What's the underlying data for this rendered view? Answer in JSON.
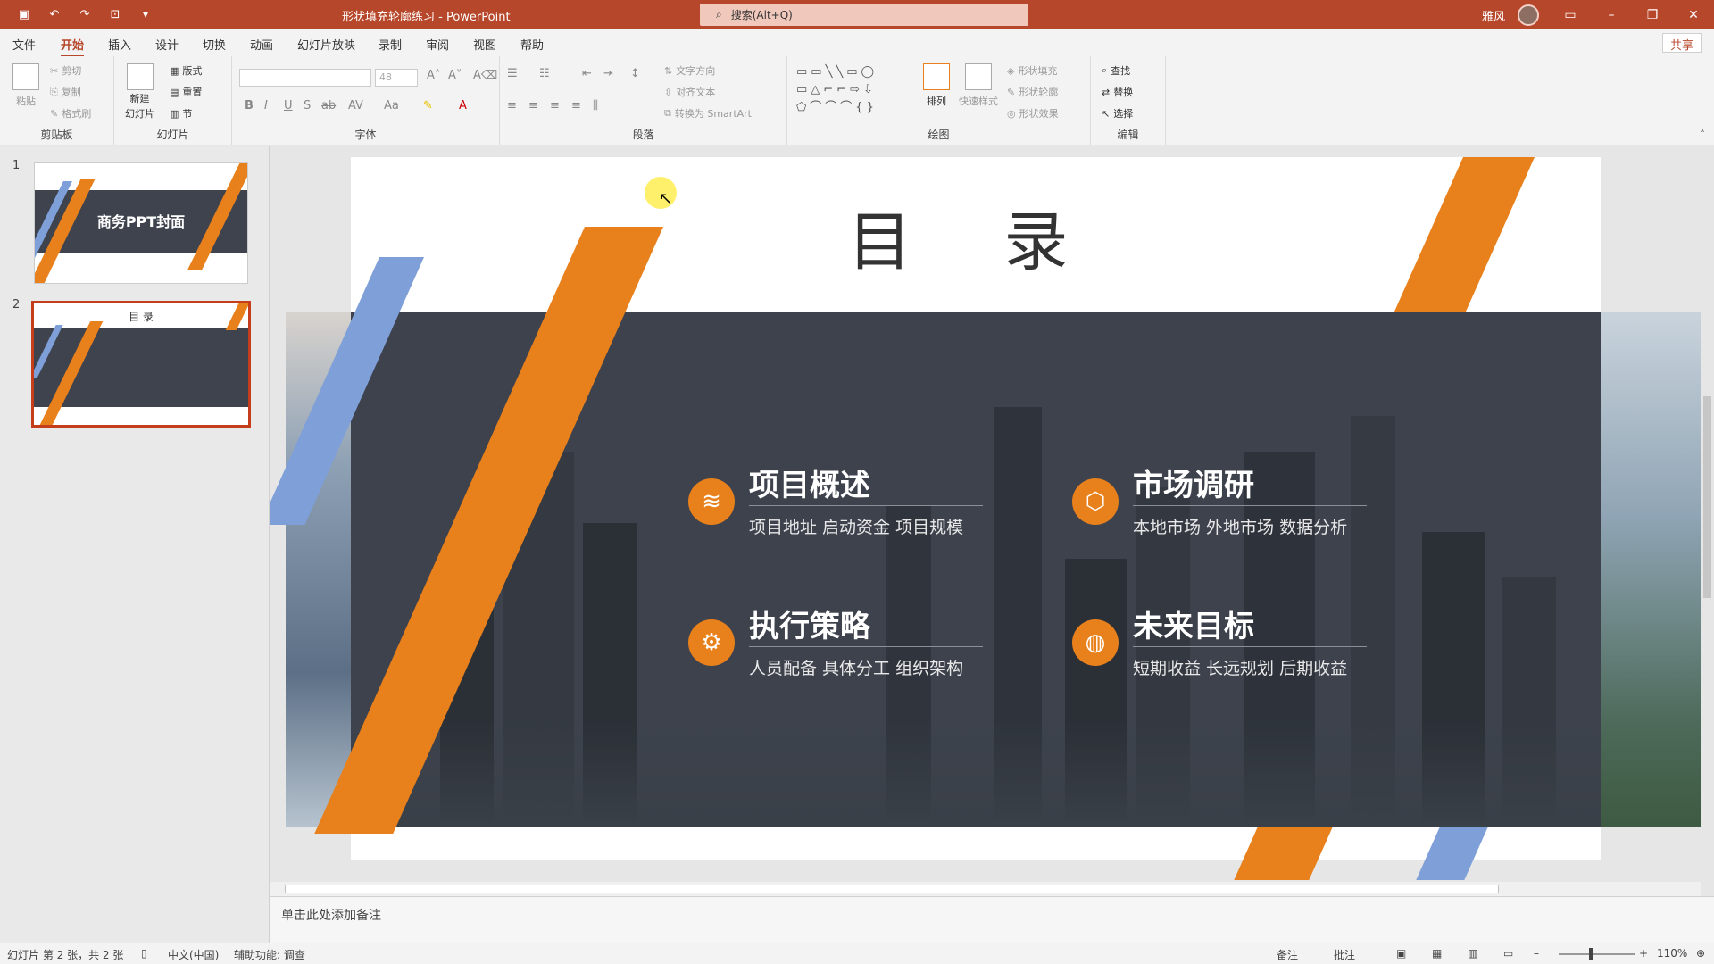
{
  "titlebar": {
    "doc_title": "形状填充轮廓练习  -  PowerPoint",
    "search_placeholder": "搜索(Alt+Q)",
    "user": "雅风"
  },
  "menu": {
    "tabs": [
      "文件",
      "开始",
      "插入",
      "设计",
      "切换",
      "动画",
      "幻灯片放映",
      "录制",
      "审阅",
      "视图",
      "帮助"
    ],
    "active_tab": "开始",
    "share": "共享"
  },
  "ribbon": {
    "clipboard": {
      "label": "剪贴板",
      "paste": "粘贴",
      "cut": "剪切",
      "copy": "复制",
      "format_painter": "格式刷"
    },
    "slides": {
      "label": "幻灯片",
      "new_slide": "新建",
      "new_slide_2": "幻灯片",
      "layout": "版式",
      "reset": "重置",
      "section": "节"
    },
    "font": {
      "label": "字体",
      "size": "48"
    },
    "paragraph": {
      "label": "段落",
      "text_direction": "文字方向",
      "align_text": "对齐文本",
      "smartart": "转换为 SmartArt"
    },
    "drawing": {
      "label": "绘图",
      "arrange": "排列",
      "quick_styles": "快速样式",
      "fill": "形状填充",
      "outline": "形状轮廓",
      "effects": "形状效果"
    },
    "editing": {
      "label": "编辑",
      "find": "查找",
      "replace": "替换",
      "select": "选择"
    }
  },
  "thumbnails": [
    {
      "number": "1",
      "title": "商务PPT封面"
    },
    {
      "number": "2",
      "title": "目  录"
    }
  ],
  "slide": {
    "title": "目  录",
    "items": [
      {
        "heading": "项目概述",
        "sub": "项目地址  启动资金  项目规模",
        "icon": "layers-icon"
      },
      {
        "heading": "市场调研",
        "sub": "本地市场  外地市场  数据分析",
        "icon": "box-icon"
      },
      {
        "heading": "执行策略",
        "sub": "人员配备  具体分工  组织架构",
        "icon": "gear-icon"
      },
      {
        "heading": "未来目标",
        "sub": "短期收益  长远规划  后期收益",
        "icon": "ball-icon"
      }
    ]
  },
  "notes": {
    "placeholder": "单击此处添加备注"
  },
  "status": {
    "slide_info": "幻灯片 第 2 张，共 2 张",
    "language": "中文(中国)",
    "accessibility": "辅助功能: 调查",
    "notes_btn": "备注",
    "comments_btn": "批注",
    "zoom": "110%"
  },
  "colors": {
    "accent": "#b7472a",
    "orange": "#e8801c",
    "blue": "#7f9fd8",
    "dark": "#3d424d"
  }
}
